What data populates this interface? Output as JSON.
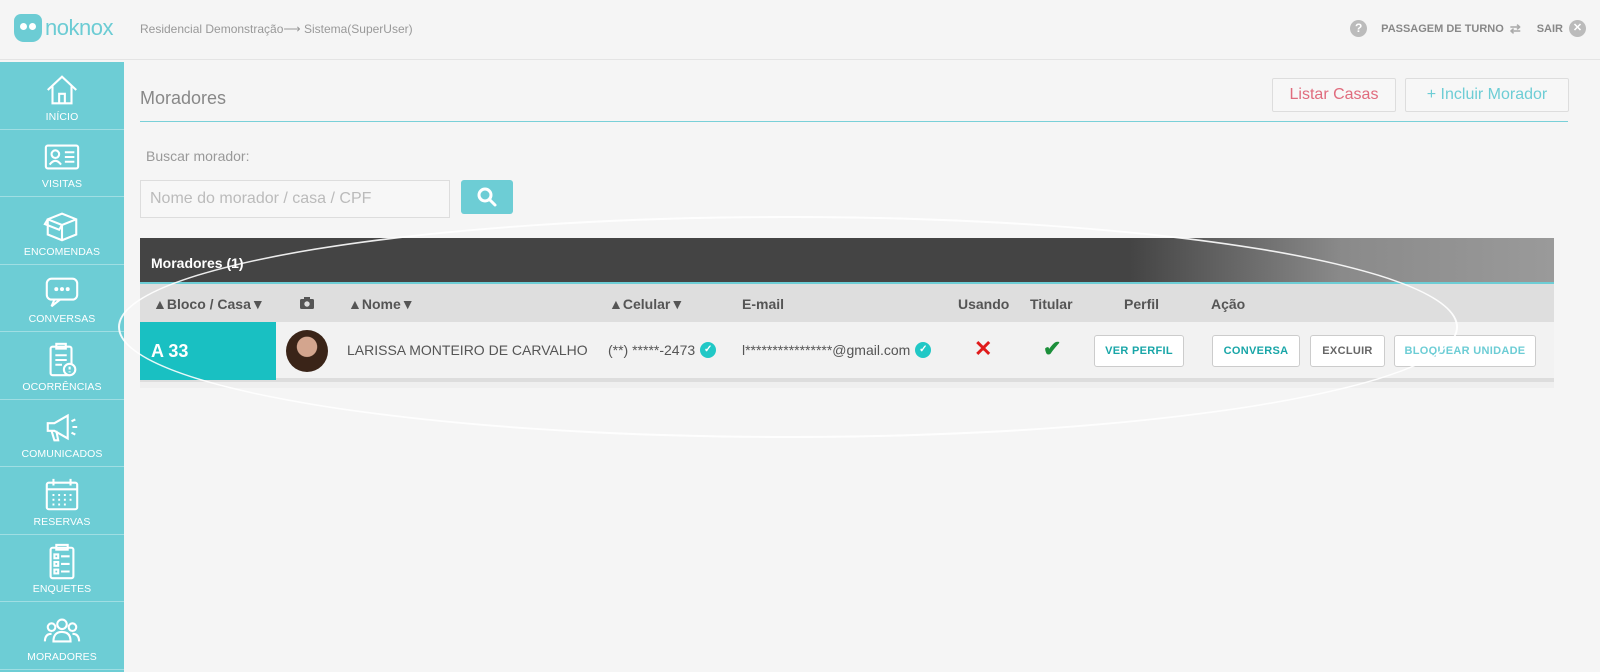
{
  "app": {
    "logo_text": "noknox",
    "breadcrumb": "Residencial Demonstração⟶ Sistema(SuperUser)"
  },
  "topbar": {
    "shift_label": "PASSAGEM DE TURNO",
    "exit_label": "SAIR"
  },
  "sidebar": {
    "items": [
      {
        "label": "INÍCIO",
        "icon": "home-icon"
      },
      {
        "label": "VISITAS",
        "icon": "id-card-icon"
      },
      {
        "label": "ENCOMENDAS",
        "icon": "package-icon"
      },
      {
        "label": "CONVERSAS",
        "icon": "chat-icon"
      },
      {
        "label": "OCORRÊNCIAS",
        "icon": "clipboard-alert-icon"
      },
      {
        "label": "COMUNICADOS",
        "icon": "megaphone-icon"
      },
      {
        "label": "RESERVAS",
        "icon": "calendar-icon"
      },
      {
        "label": "ENQUETES",
        "icon": "checklist-icon"
      },
      {
        "label": "MORADORES",
        "icon": "people-icon"
      }
    ]
  },
  "page": {
    "title": "Moradores",
    "list_houses_label": "Listar Casas",
    "add_resident_label": "+ Incluir Morador"
  },
  "search": {
    "label": "Buscar morador:",
    "placeholder": "Nome do morador / casa / CPF",
    "value": ""
  },
  "table": {
    "title": "Moradores (1)",
    "columns": {
      "bloco": "▲Bloco / Casa▼",
      "nome": "▲Nome▼",
      "celular": "▲Celular▼",
      "email": "E-mail",
      "usando": "Usando",
      "titular": "Titular",
      "perfil": "Perfil",
      "acao": "Ação"
    },
    "rows": [
      {
        "unit": "A 33",
        "name": "LARISSA MONTEIRO DE CARVALHO",
        "phone": "(**) *****-2473",
        "email": "l****************@gmail.com",
        "using": false,
        "holder": true,
        "profile_label": "VER PERFIL",
        "chat_label": "CONVERSA",
        "delete_label": "EXCLUIR",
        "block_label": "BLOQUEAR UNIDADE"
      }
    ]
  },
  "colors": {
    "accent": "#6dcdd5",
    "unit_bg": "#19c0c2",
    "danger": "#e01b1b",
    "success": "#1c8f3a",
    "brand_pink": "#e06b7d"
  }
}
